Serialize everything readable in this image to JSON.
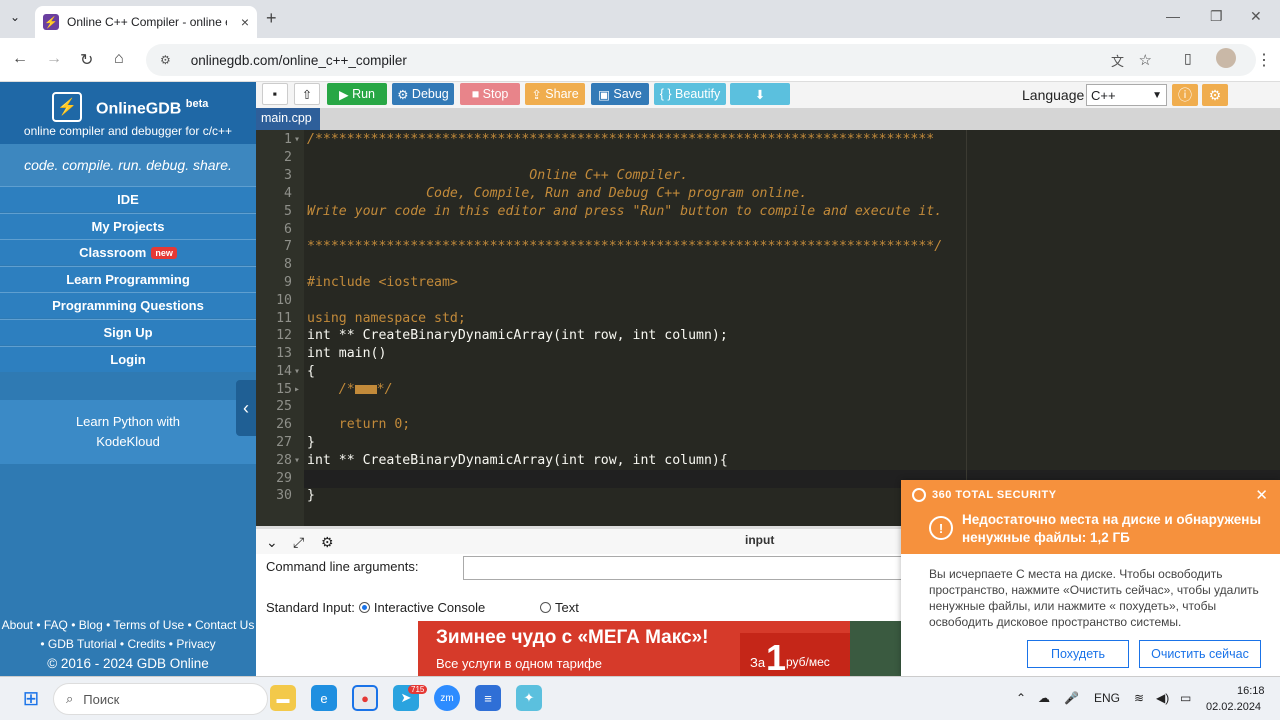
{
  "browser": {
    "tab_title": "Online C++ Compiler - online e",
    "url": "onlinegdb.com/online_c++_compiler"
  },
  "sidebar": {
    "brand": "OnlineGDB",
    "beta": "beta",
    "subtitle": "online compiler and debugger for c/c++",
    "tagline": "code. compile. run. debug. share.",
    "items": [
      {
        "label": "IDE"
      },
      {
        "label": "My Projects"
      },
      {
        "label": "Classroom",
        "badge": "new"
      },
      {
        "label": "Learn Programming"
      },
      {
        "label": "Programming Questions"
      },
      {
        "label": "Sign Up"
      },
      {
        "label": "Login"
      }
    ],
    "promo": "Learn Python with KodeKloud",
    "footer_line1": "About • FAQ • Blog • Terms of Use • Contact Us",
    "footer_line2": "• GDB Tutorial • Credits • Privacy",
    "footer_copy": "© 2016 - 2024 GDB Online"
  },
  "toolbar": {
    "run": "Run",
    "debug": "Debug",
    "stop": "Stop",
    "share": "Share",
    "save": "Save",
    "beautify": "{ } Beautify",
    "language_label": "Language",
    "language_value": "C++",
    "colors": {
      "run": "#28a745",
      "debug": "#337ab7",
      "stop": "#e74c3c",
      "share": "#f0ad4e",
      "save": "#337ab7",
      "beautify": "#5bc0de"
    }
  },
  "editor": {
    "file_tab": "main.cpp",
    "lines": [
      {
        "n": "1",
        "text": "/******************************************************************************"
      },
      {
        "n": "2",
        "text": ""
      },
      {
        "n": "3",
        "text": "                            Online C++ Compiler."
      },
      {
        "n": "4",
        "text": "               Code, Compile, Run and Debug C++ program online."
      },
      {
        "n": "5",
        "text": "Write your code in this editor and press \"Run\" button to compile and execute it."
      },
      {
        "n": "6",
        "text": ""
      },
      {
        "n": "7",
        "text": "*******************************************************************************/"
      },
      {
        "n": "8",
        "text": ""
      },
      {
        "n": "9",
        "text": "#include <iostream>"
      },
      {
        "n": "10",
        "text": ""
      },
      {
        "n": "11",
        "text": "using namespace std;"
      },
      {
        "n": "12",
        "text": "int ** CreateBinaryDynamicArray(int row, int column);"
      },
      {
        "n": "13",
        "text": "int main()"
      },
      {
        "n": "14",
        "text": "{"
      },
      {
        "n": "15",
        "text": "    /*"
      },
      {
        "n": "25",
        "text": ""
      },
      {
        "n": "26",
        "text": "    return 0;"
      },
      {
        "n": "27",
        "text": "}"
      },
      {
        "n": "28",
        "text": "int ** CreateBinaryDynamicArray(int row, int column){"
      },
      {
        "n": "29",
        "text": "    "
      },
      {
        "n": "30",
        "text": "}"
      }
    ]
  },
  "bottom": {
    "input_label": "input",
    "cmd_label": "Command line arguments:",
    "stdin_label": "Standard Input:",
    "opt_interactive": "Interactive Console",
    "opt_text": "Text",
    "ad_headline": "Зимнее чудо с «МЕГА Макс»!",
    "ad_sub": "Все услуги в одном тарифе",
    "ad_za": "За",
    "ad_one": "1",
    "ad_rub": "руб/мес"
  },
  "popup": {
    "brand": "360 TOTAL SECURITY",
    "headline": "Недостаточно места на диске и обнаружены ненужные файлы: 1,2 ГБ",
    "body": "Вы исчерпаете С места на диске. Чтобы освободить пространство, нажмите «Очистить сейчас», чтобы удалить ненужные файлы, или нажмите « похудеть», чтобы освободить дисковое пространство системы.",
    "btn_slim": "Похудеть",
    "btn_clean": "Очистить сейчас"
  },
  "taskbar": {
    "search": "Поиск",
    "telegram_badge": "715",
    "lang": "ENG",
    "time": "16:18",
    "date": "02.02.2024"
  }
}
